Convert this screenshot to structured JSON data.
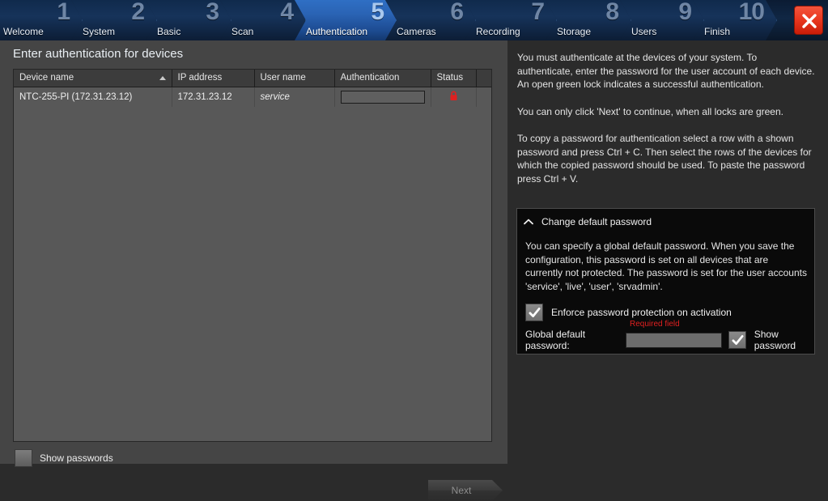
{
  "wizard": {
    "steps": [
      {
        "number": "1",
        "label": "Welcome",
        "active": false
      },
      {
        "number": "2",
        "label": "System",
        "active": false
      },
      {
        "number": "3",
        "label": "Basic",
        "active": false
      },
      {
        "number": "4",
        "label": "Scan",
        "active": false
      },
      {
        "number": "5",
        "label": "Authentication",
        "active": true
      },
      {
        "number": "6",
        "label": "Cameras",
        "active": false
      },
      {
        "number": "7",
        "label": "Recording",
        "active": false
      },
      {
        "number": "8",
        "label": "Storage",
        "active": false
      },
      {
        "number": "9",
        "label": "Users",
        "active": false
      },
      {
        "number": "10",
        "label": "Finish",
        "active": false
      }
    ],
    "close_icon": "close-icon",
    "active_color": "#2a63b4",
    "close_color": "#e8361e"
  },
  "main": {
    "title": "Enter authentication for devices",
    "table": {
      "columns": [
        "Device name",
        "IP address",
        "User name",
        "Authentication",
        "Status",
        ""
      ],
      "sorted_column": "Device name",
      "sort_direction": "ascending",
      "rows": [
        {
          "device_name": "NTC-255-PI (172.31.23.12)",
          "ip_address": "172.31.23.12",
          "user_name": "service",
          "authentication": "",
          "status_icon": "lock-closed-icon",
          "status_color": "#e02020"
        }
      ]
    },
    "show_passwords": {
      "label": "Show passwords",
      "checked": false
    },
    "next_button": {
      "label": "Next",
      "enabled": false
    }
  },
  "help": {
    "paragraph_1": "You must authenticate at the devices of your system. To authenticate, enter the password for the user account of each device. An open green lock indicates a successful authentication.",
    "paragraph_2": "You can only click 'Next' to continue, when all locks are green.",
    "paragraph_3": "To copy a password for authentication select a row with a shown password and press Ctrl + C. Then select the rows of the devices for which the copied password should be used. To paste the password press Ctrl + V."
  },
  "change_password_panel": {
    "title": "Change default password",
    "collapse_icon": "chevron-up-icon",
    "expanded": true,
    "body_text": "You can specify a global default password. When you save the configuration, this password is set on all devices that are currently not protected. The password is set for the user accounts 'service', 'live', 'user', 'srvadmin'.",
    "enforce_checkbox": {
      "label": "Enforce password protection on activation",
      "checked": true
    },
    "required_field_text": "Required field",
    "global_default_password": {
      "label": "Global default password:",
      "value": "",
      "placeholder": ""
    },
    "show_password_checkbox": {
      "label": "Show password",
      "checked": true
    }
  }
}
